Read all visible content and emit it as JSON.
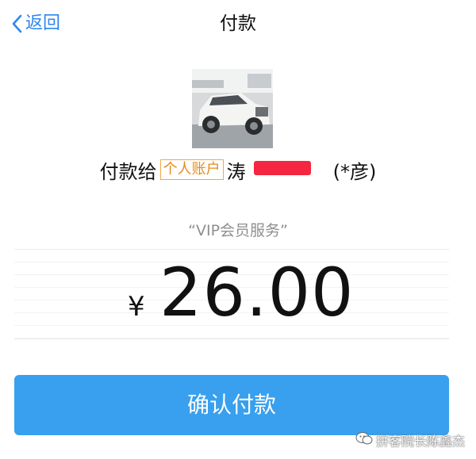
{
  "nav": {
    "back_label": "返回",
    "title": "付款"
  },
  "payee": {
    "prefix": "付款给",
    "account_tag": "个人账户",
    "name_start": "涛",
    "name_end": "(*彦)"
  },
  "service_note": "“VIP会员服务”",
  "payment": {
    "currency": "¥",
    "amount": "26.00"
  },
  "confirm_button": "确认付款",
  "watermark": "拼客院长陈鑫杰",
  "colors": {
    "accent": "#2e86f2",
    "button": "#38a0ee",
    "tag": "#e48a1c",
    "redaction": "#f5263f"
  },
  "icons": {
    "back": "chevron-left-icon",
    "watermark": "wechat-icon"
  }
}
